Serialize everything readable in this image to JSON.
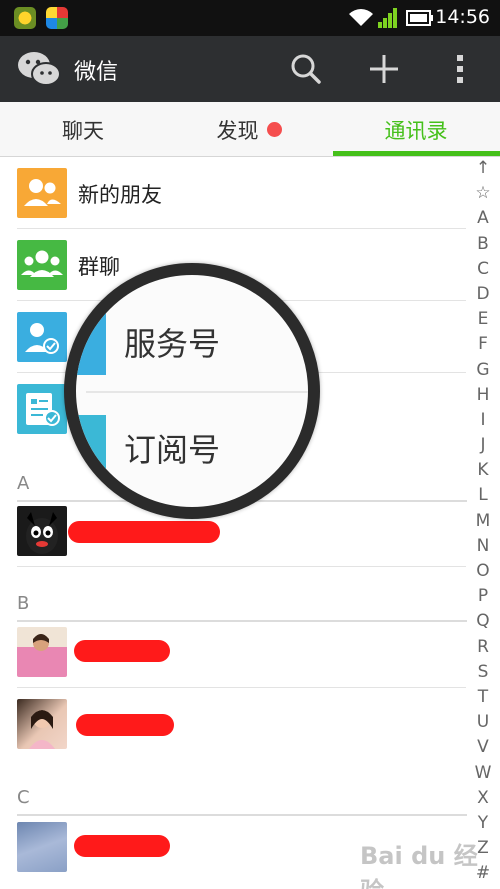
{
  "status_bar": {
    "time": "14:56",
    "icons": [
      "notification-app-icon",
      "notification-store-icon",
      "wifi-icon",
      "signal-icon",
      "battery-icon"
    ]
  },
  "action_bar": {
    "title": "微信",
    "icons": [
      "wechat-logo-icon",
      "search-icon",
      "plus-icon",
      "more-icon"
    ]
  },
  "tabs": [
    {
      "label": "聊天",
      "active": false
    },
    {
      "label": "发现",
      "active": false,
      "badge": true
    },
    {
      "label": "通讯录",
      "active": true
    }
  ],
  "colors": {
    "accent": "#45c01a",
    "badge": "#f54e4e",
    "action_bar": "#2d2f31",
    "new_friends": "#f8a836",
    "group_chat": "#46b943",
    "service": "#3aaee0"
  },
  "contacts_top": [
    {
      "label": "新的朋友",
      "icon": "new-friends-icon"
    },
    {
      "label": "群聊",
      "icon": "group-chat-icon"
    },
    {
      "label": "",
      "icon": "service-account-icon"
    },
    {
      "label": "",
      "icon": "subscription-account-icon"
    }
  ],
  "magnifier": {
    "service_label": "服务号",
    "subscription_label": "订阅号"
  },
  "sections": [
    {
      "letter": "A"
    },
    {
      "letter": "B"
    },
    {
      "letter": "C"
    }
  ],
  "index_letters": [
    "↑",
    "☆",
    "A",
    "B",
    "C",
    "D",
    "E",
    "F",
    "G",
    "H",
    "I",
    "J",
    "K",
    "L",
    "M",
    "N",
    "O",
    "P",
    "Q",
    "R",
    "S",
    "T",
    "U",
    "V",
    "W",
    "X",
    "Y",
    "Z",
    "#"
  ],
  "watermark": "Bai du 经验"
}
